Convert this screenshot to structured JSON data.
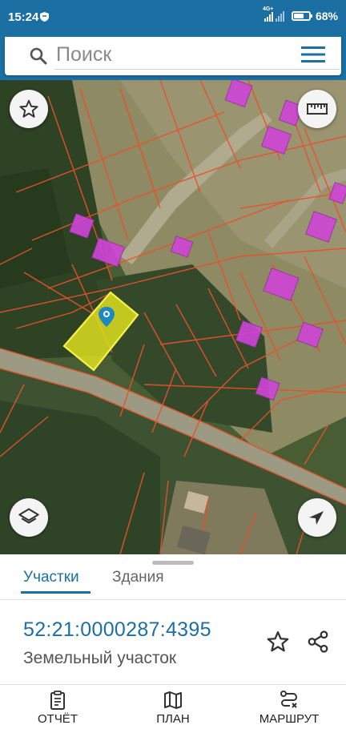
{
  "status_bar": {
    "time": "15:24",
    "network": "4G+",
    "battery": "68%",
    "battery_level": 0.68
  },
  "search": {
    "placeholder": "Поиск",
    "search_icon": "search-icon",
    "menu_icon": "hamburger-menu-icon"
  },
  "map": {
    "controls": [
      "star-outline-icon",
      "ruler-icon",
      "layers-icon",
      "navigation-arrow-icon"
    ],
    "colors": {
      "parcel_lines": "#e8512a",
      "selected_parcel": "#e3e41e",
      "buildings": "#cf45d8",
      "pin": "#1c88c4"
    }
  },
  "sheet": {
    "tabs": [
      {
        "label": "Участки",
        "active": true
      },
      {
        "label": "Здания",
        "active": false
      }
    ],
    "parcel_id": "52:21:0000287:4395",
    "parcel_type": "Земельный участок",
    "actions": [
      "star-outline-icon",
      "share-icon"
    ]
  },
  "bottom_nav": {
    "items": [
      {
        "label": "ОТЧЁТ",
        "icon": "report-clipboard-icon"
      },
      {
        "label": "ПЛАН",
        "icon": "map-plan-icon"
      },
      {
        "label": "МАРШРУТ",
        "icon": "route-icon"
      }
    ]
  },
  "colors": {
    "accent": "#1c6fa3"
  }
}
